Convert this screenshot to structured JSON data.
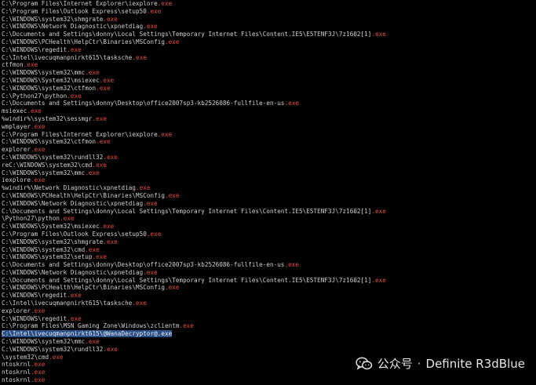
{
  "terminal": {
    "lines": [
      {
        "path": "C:\\Program Files\\Internet Explorer\\iexplore",
        "ext": ".exe"
      },
      {
        "path": "C:\\Program Files\\Outlook Express\\setup50",
        "ext": ".exe"
      },
      {
        "path": "C:\\WINDOWS\\system32\\shmgrate",
        "ext": ".exe"
      },
      {
        "path": "C:\\WINDOWS\\Network Diagnostic\\xpnetdiag",
        "ext": ".exe"
      },
      {
        "path": "C:\\Documents and Settings\\donny\\Local Settings\\Temporary Internet Files\\Content.IE5\\E5TENF3J\\7z1602[1]",
        "ext": ".exe"
      },
      {
        "path": "C:\\WINDOWS\\PCHealth\\HelpCtr\\Binaries\\MSConfig",
        "ext": ".exe"
      },
      {
        "path": "C:\\WINDOWS\\regedit",
        "ext": ".exe"
      },
      {
        "path": "C:\\Intel\\ivecuqmanpnirkt615\\tasksche",
        "ext": ".exe"
      },
      {
        "path": "ctfmon",
        "ext": ".exe"
      },
      {
        "path": "C:\\WINDOWS\\system32\\mmc",
        "ext": ".exe"
      },
      {
        "path": "C:\\WINDOWS\\System32\\msiexec",
        "ext": ".exe"
      },
      {
        "path": "C:\\WINDOWS\\system32\\ctfmon",
        "ext": ".exe"
      },
      {
        "path": "C:\\Python27\\python",
        "ext": ".exe"
      },
      {
        "path": "C:\\Documents and Settings\\donny\\Desktop\\office2007sp3-kb2526086-fullfile-en-us",
        "ext": ".exe"
      },
      {
        "path": "msiexec",
        "ext": ".exe"
      },
      {
        "path": "%windir%\\system32\\sessmgr",
        "ext": ".exe"
      },
      {
        "path": "wmplayer",
        "ext": ".exe"
      },
      {
        "path": "C:\\Program Files\\Internet Explorer\\iexplore",
        "ext": ".exe"
      },
      {
        "path": "C:\\WINDOWS\\system32\\ctfmon",
        "ext": ".exe"
      },
      {
        "path": "explorer",
        "ext": ".exe"
      },
      {
        "path": "C:\\WINDOWS\\system32\\rundll32",
        "ext": ".exe"
      },
      {
        "path": "reC:\\WINDOWS\\system32\\cmd",
        "ext": ".exe"
      },
      {
        "path": "C:\\WINDOWS\\system32\\mmc",
        "ext": ".exe"
      },
      {
        "path": "iexplore",
        "ext": ".exe"
      },
      {
        "path": "%windir%\\Network Diagnostic\\xpnetdiag",
        "ext": ".exe"
      },
      {
        "path": "C:\\WINDOWS\\PCHealth\\HelpCtr\\Binaries\\MSConfig",
        "ext": ".exe"
      },
      {
        "path": "C:\\WINDOWS\\Network Diagnostic\\xpnetdiag",
        "ext": ".exe"
      },
      {
        "path": "C:\\Documents and Settings\\donny\\Local Settings\\Temporary Internet Files\\Content.IE5\\E5TENF3J\\7z1602[1]",
        "ext": ".exe"
      },
      {
        "path": "\\Python27\\python",
        "ext": ".exe"
      },
      {
        "path": "C:\\WINDOWS\\System32\\msiexec",
        "ext": ".exe"
      },
      {
        "path": "C:\\Program Files\\Outlook Express\\setup50",
        "ext": ".exe"
      },
      {
        "path": "C:\\WINDOWS\\system32\\shmgrate",
        "ext": ".exe"
      },
      {
        "path": "C:\\WINDOWS\\system32\\cmd",
        "ext": ".exe"
      },
      {
        "path": "C:\\WINDOWS\\system32\\setup",
        "ext": ".exe"
      },
      {
        "path": "C:\\Documents and Settings\\donny\\Desktop\\office2007sp3-kb2526086-fullfile-en-us",
        "ext": ".exe"
      },
      {
        "path": "C:\\WINDOWS\\Network Diagnostic\\xpnetdiag",
        "ext": ".exe"
      },
      {
        "path": "C:\\Documents and Settings\\donny\\Local Settings\\Temporary Internet Files\\Content.IE5\\E5TENF3J\\7z1602[1]",
        "ext": ".exe"
      },
      {
        "path": "C:\\WINDOWS\\PCHealth\\HelpCtr\\Binaries\\MSConfig",
        "ext": ".exe"
      },
      {
        "path": "C:\\WINDOWS\\regedit",
        "ext": ".exe"
      },
      {
        "path": "C:\\Intel\\ivecuqmanpnirkt615\\tasksche",
        "ext": ".exe"
      },
      {
        "path": "explorer",
        "ext": ".exe"
      },
      {
        "path": "C:\\WINDOWS\\regedit",
        "ext": ".exe"
      },
      {
        "path": "C:\\Program Files\\MSN Gaming Zone\\Windows\\zclientm",
        "ext": ".exe"
      },
      {
        "path": "C:\\Intel\\ivecuqmanpnirkt615\\@WanaDecryptor@",
        "ext": ".exe",
        "selected": true
      },
      {
        "path": "C:\\WINDOWS\\system32\\mmc",
        "ext": ".exe"
      },
      {
        "path": "C:\\WINDOWS\\system32\\rundll32",
        "ext": ".exe"
      },
      {
        "path": "\\system32\\cmd",
        "ext": ".exe"
      },
      {
        "path": "ntoskrnl",
        "ext": ".exe"
      },
      {
        "path": "ntoskrnl",
        "ext": ".exe"
      },
      {
        "path": "ntoskrnl",
        "ext": ".exe"
      },
      {
        "path": "ntoskrnl",
        "ext": ".exe"
      }
    ]
  },
  "watermark": {
    "icon": "wechat-icon",
    "label": "公众号",
    "separator": "·",
    "account": "Definite R3dBlue"
  },
  "colors": {
    "background": "#000000",
    "text": "#d0d0d0",
    "extension": "#e34a3f",
    "selection": "#2a4f86"
  }
}
